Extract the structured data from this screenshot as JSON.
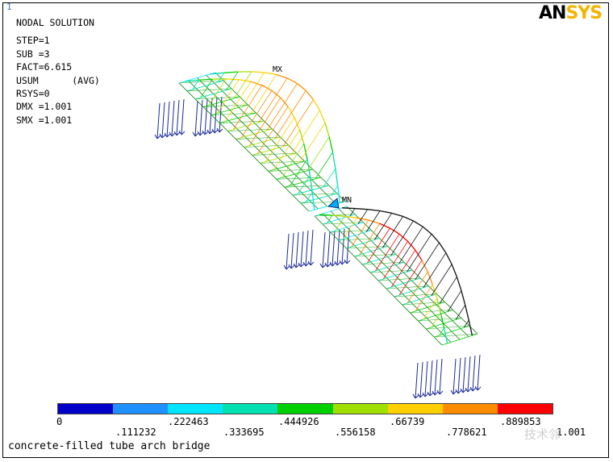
{
  "window_number": "1",
  "logo": {
    "an": "AN",
    "sys": "SYS"
  },
  "info": {
    "title": "NODAL SOLUTION",
    "lines": [
      "STEP=1",
      "SUB =3",
      "FACT=6.615",
      "USUM      (AVG)",
      "RSYS=0",
      "DMX =1.001",
      "SMX =1.001"
    ]
  },
  "markers": {
    "max": "MX",
    "min": "MN"
  },
  "legend": {
    "colors": [
      "#0000c8",
      "#1e90ff",
      "#00e5ff",
      "#00e0b0",
      "#00d000",
      "#a0e000",
      "#ffd000",
      "#ff8c00",
      "#ff0000"
    ],
    "top_labels": [
      "0",
      ".222463",
      ".444926",
      ".66739",
      ".889853"
    ],
    "bottom_labels": [
      ".111232",
      ".333695",
      ".556158",
      ".778621",
      "1.001"
    ]
  },
  "caption": "concrete-filled tube arch bridge",
  "watermark": "技术邻"
}
